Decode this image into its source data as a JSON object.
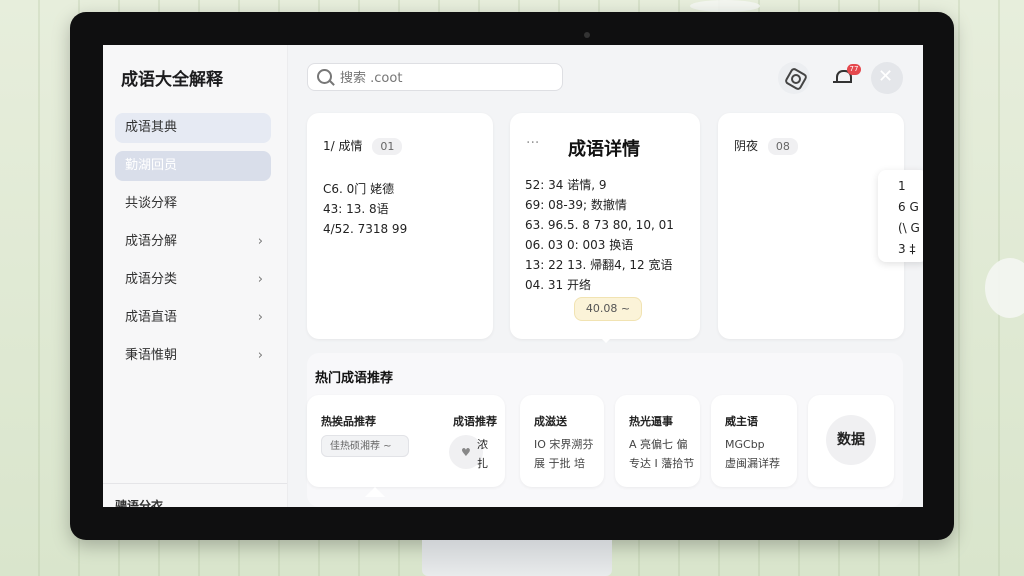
{
  "app": {
    "title": "成语大全解释"
  },
  "search": {
    "placeholder": "搜索 .coot"
  },
  "header": {
    "notification_count": "77"
  },
  "sidebar": {
    "items": [
      {
        "label": "成语其典"
      },
      {
        "label": "勤湖回员"
      },
      {
        "label": "共谈分释"
      },
      {
        "label": "成语分解"
      },
      {
        "label": "成语分类"
      },
      {
        "label": "成语直语"
      },
      {
        "label": "秉语惟朝"
      }
    ],
    "footer": "骋语分衣"
  },
  "cards": {
    "left": {
      "head": "1/  成情",
      "chip": "01",
      "lines": [
        "C6. 0门 姥德",
        "43: 13. 8语",
        "4/52. 7318 99"
      ]
    },
    "center": {
      "title": "成语详情",
      "lines": [
        "52: 34  诺情, 9",
        "69: 08-39; 数撤情",
        "63. 96.5. 8 73  80,  10,  01",
        "06. 03  0: 003 换语",
        "13: 22  13. 帰翻4,  12  宽语",
        "04. 31  开络"
      ],
      "pill": "40.08 ~"
    },
    "right": {
      "head": "阴夜",
      "chip": "08"
    }
  },
  "popover": {
    "lines": [
      "1",
      "6  G",
      "(\\  G",
      "3  ‡"
    ]
  },
  "hot": {
    "title": "热门成语推荐",
    "card1": {
      "title": "热挨品推荐",
      "select": "佳热硕湘荐 ~",
      "title2": "成语推荐",
      "side_lines": [
        "浓",
        "扎"
      ]
    },
    "card2": {
      "title": "成滋送",
      "lines": [
        "IO 宋界溯芬",
        "展  于批  培"
      ]
    },
    "card3": {
      "title": "热光逼事",
      "lines": [
        "A 亮偏七  偏",
        "专达 I 藩拾节"
      ]
    },
    "card4": {
      "title": "威主语",
      "lines": [
        "MGCbp",
        "虚闽漏详荐"
      ]
    },
    "card5": {
      "label": "数据"
    }
  }
}
